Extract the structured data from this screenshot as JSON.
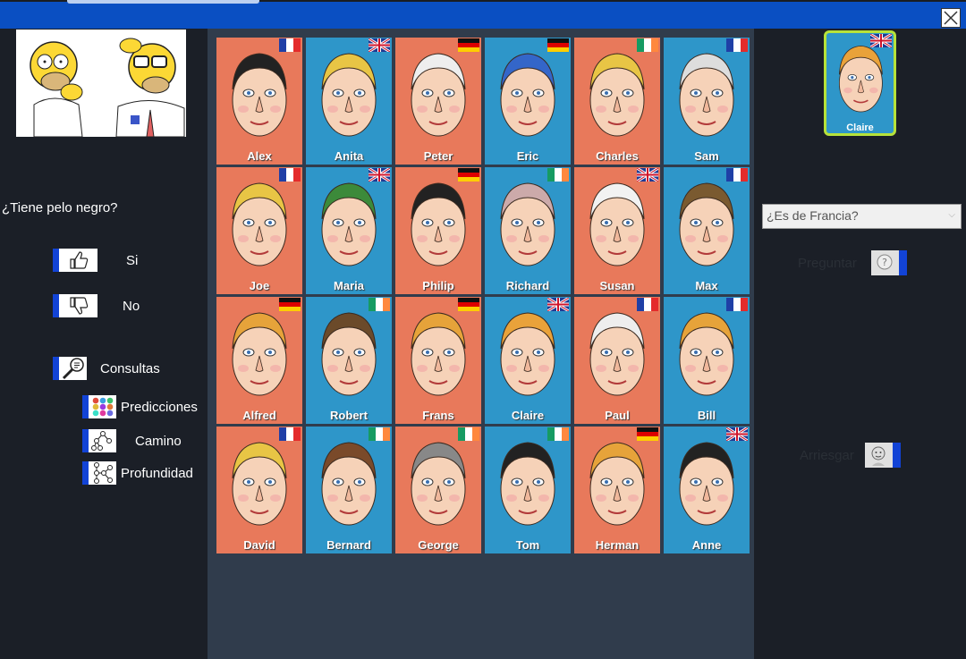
{
  "window": {
    "close_icon": "close-icon"
  },
  "left_panel": {
    "question": "¿Tiene pelo negro?",
    "yes_label": "Si",
    "no_label": "No",
    "consultas_label": "Consultas",
    "predicciones_label": "Predicciones",
    "camino_label": "Camino",
    "profundidad_label": "Profundidad"
  },
  "characters": [
    {
      "name": "Alex",
      "flag": "FR",
      "bg": "#e8795b"
    },
    {
      "name": "Anita",
      "flag": "UK",
      "bg": "#2e96c9"
    },
    {
      "name": "Peter",
      "flag": "DE",
      "bg": "#e8795b"
    },
    {
      "name": "Eric",
      "flag": "DE",
      "bg": "#2e96c9"
    },
    {
      "name": "Charles",
      "flag": "IE",
      "bg": "#e8795b"
    },
    {
      "name": "Sam",
      "flag": "FR",
      "bg": "#2e96c9"
    },
    {
      "name": "Joe",
      "flag": "FR",
      "bg": "#e8795b"
    },
    {
      "name": "Maria",
      "flag": "UK",
      "bg": "#2e96c9"
    },
    {
      "name": "Philip",
      "flag": "DE",
      "bg": "#e8795b"
    },
    {
      "name": "Richard",
      "flag": "IE",
      "bg": "#2e96c9"
    },
    {
      "name": "Susan",
      "flag": "UK",
      "bg": "#e8795b"
    },
    {
      "name": "Max",
      "flag": "FR",
      "bg": "#2e96c9"
    },
    {
      "name": "Alfred",
      "flag": "DE",
      "bg": "#e8795b"
    },
    {
      "name": "Robert",
      "flag": "IE",
      "bg": "#2e96c9"
    },
    {
      "name": "Frans",
      "flag": "DE",
      "bg": "#e8795b"
    },
    {
      "name": "Claire",
      "flag": "UK",
      "bg": "#2e96c9"
    },
    {
      "name": "Paul",
      "flag": "FR",
      "bg": "#e8795b"
    },
    {
      "name": "Bill",
      "flag": "FR",
      "bg": "#2e96c9"
    },
    {
      "name": "David",
      "flag": "FR",
      "bg": "#e8795b"
    },
    {
      "name": "Bernard",
      "flag": "IE",
      "bg": "#2e96c9"
    },
    {
      "name": "George",
      "flag": "IE",
      "bg": "#e8795b"
    },
    {
      "name": "Tom",
      "flag": "IE",
      "bg": "#2e96c9"
    },
    {
      "name": "Herman",
      "flag": "DE",
      "bg": "#e8795b"
    },
    {
      "name": "Anne",
      "flag": "UK",
      "bg": "#2e96c9"
    }
  ],
  "right_panel": {
    "selected_name": "Claire",
    "question_select_value": "¿Es de Francia?",
    "preguntar_label": "Preguntar",
    "arriesgar_label": "Arriesgar"
  },
  "colors": {
    "accent": "#1243d6",
    "titlebar": "#0a4fc2",
    "panel_dark": "#1b1f27",
    "board_bg": "#303c4c",
    "card_orange": "#e8795b",
    "card_blue": "#2e96c9",
    "selected_border": "#b7e23a"
  }
}
